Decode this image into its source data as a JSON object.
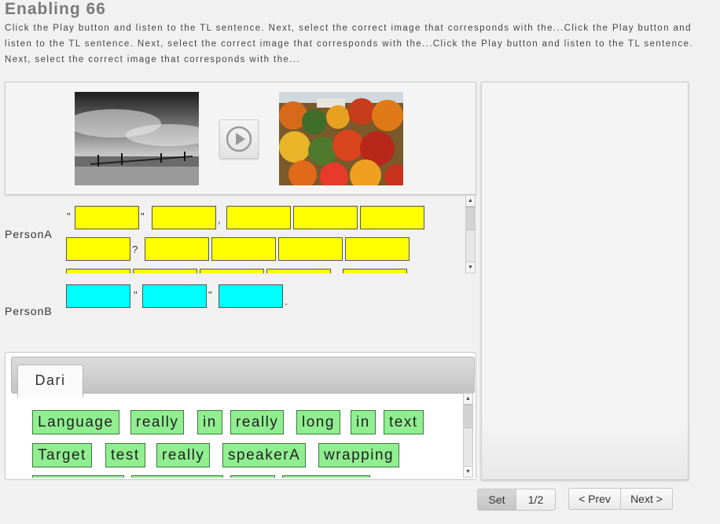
{
  "page": {
    "title": "Enabling 66",
    "instructions": "Click the Play button and listen to the TL sentence. Next, select the correct image that corresponds with the...Click the Play button and listen to the TL sentence. Next, select the correct image that corresponds with the...Click the Play button and listen to the TL sentence. Next, select the correct image that corresponds with the..."
  },
  "media": {
    "image1_desc_icon": "landscape-bw-icon",
    "image2_desc_icon": "autumn-forest-icon",
    "play_icon": "play-icon"
  },
  "dialogue": {
    "person_a_label": "PersonA",
    "person_b_label": "PersonB",
    "punct_quote": "\"",
    "punct_comma": ",",
    "punct_question": "?",
    "punct_period": "."
  },
  "word_bank": {
    "tab_label": "Dari",
    "words": [
      "Language",
      "really",
      "in",
      "really",
      "long",
      "in",
      "text",
      "Target",
      "test",
      "really",
      "speakerA",
      "wrapping"
    ]
  },
  "footer": {
    "set_label": "Set",
    "page_indicator": "1/2",
    "prev_label": "< Prev",
    "next_label": "Next >"
  },
  "colors": {
    "blank_a": "#ffff00",
    "blank_b": "#00ffff",
    "word_chip": "#90ee90"
  }
}
